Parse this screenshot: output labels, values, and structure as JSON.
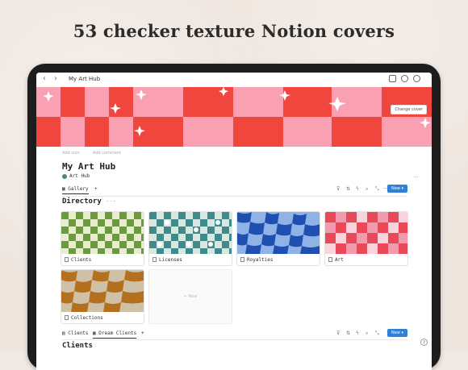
{
  "headline": "53 checker texture Notion covers",
  "topbar": {
    "back_icon": "‹",
    "forward_icon": "›",
    "breadcrumb": "My Art Hub"
  },
  "cover": {
    "change_cover_label": "Change cover",
    "colors": {
      "red": "#f0463e",
      "pink": "#f9a1b2",
      "star": "#ffffff"
    }
  },
  "page": {
    "add_icon": "Add icon",
    "add_comment": "Add comment",
    "title": "My Art Hub",
    "subtitle": "Art Hub",
    "more": "···"
  },
  "gallery_view": {
    "tab_label": "Gallery",
    "add_tab": "+",
    "new_button": "New"
  },
  "directory": {
    "heading": "Directory",
    "heading_more": "···",
    "cards": [
      {
        "label": "Clients"
      },
      {
        "label": "Licenses"
      },
      {
        "label": "Royalties"
      },
      {
        "label": "Art"
      },
      {
        "label": "Collections"
      }
    ],
    "new_card_label": "+ New"
  },
  "clients_view": {
    "tabs": [
      "Clients",
      "Dream Clients"
    ],
    "add_tab": "+",
    "new_button": "New"
  },
  "clients": {
    "heading": "Clients"
  },
  "help_icon": "?"
}
